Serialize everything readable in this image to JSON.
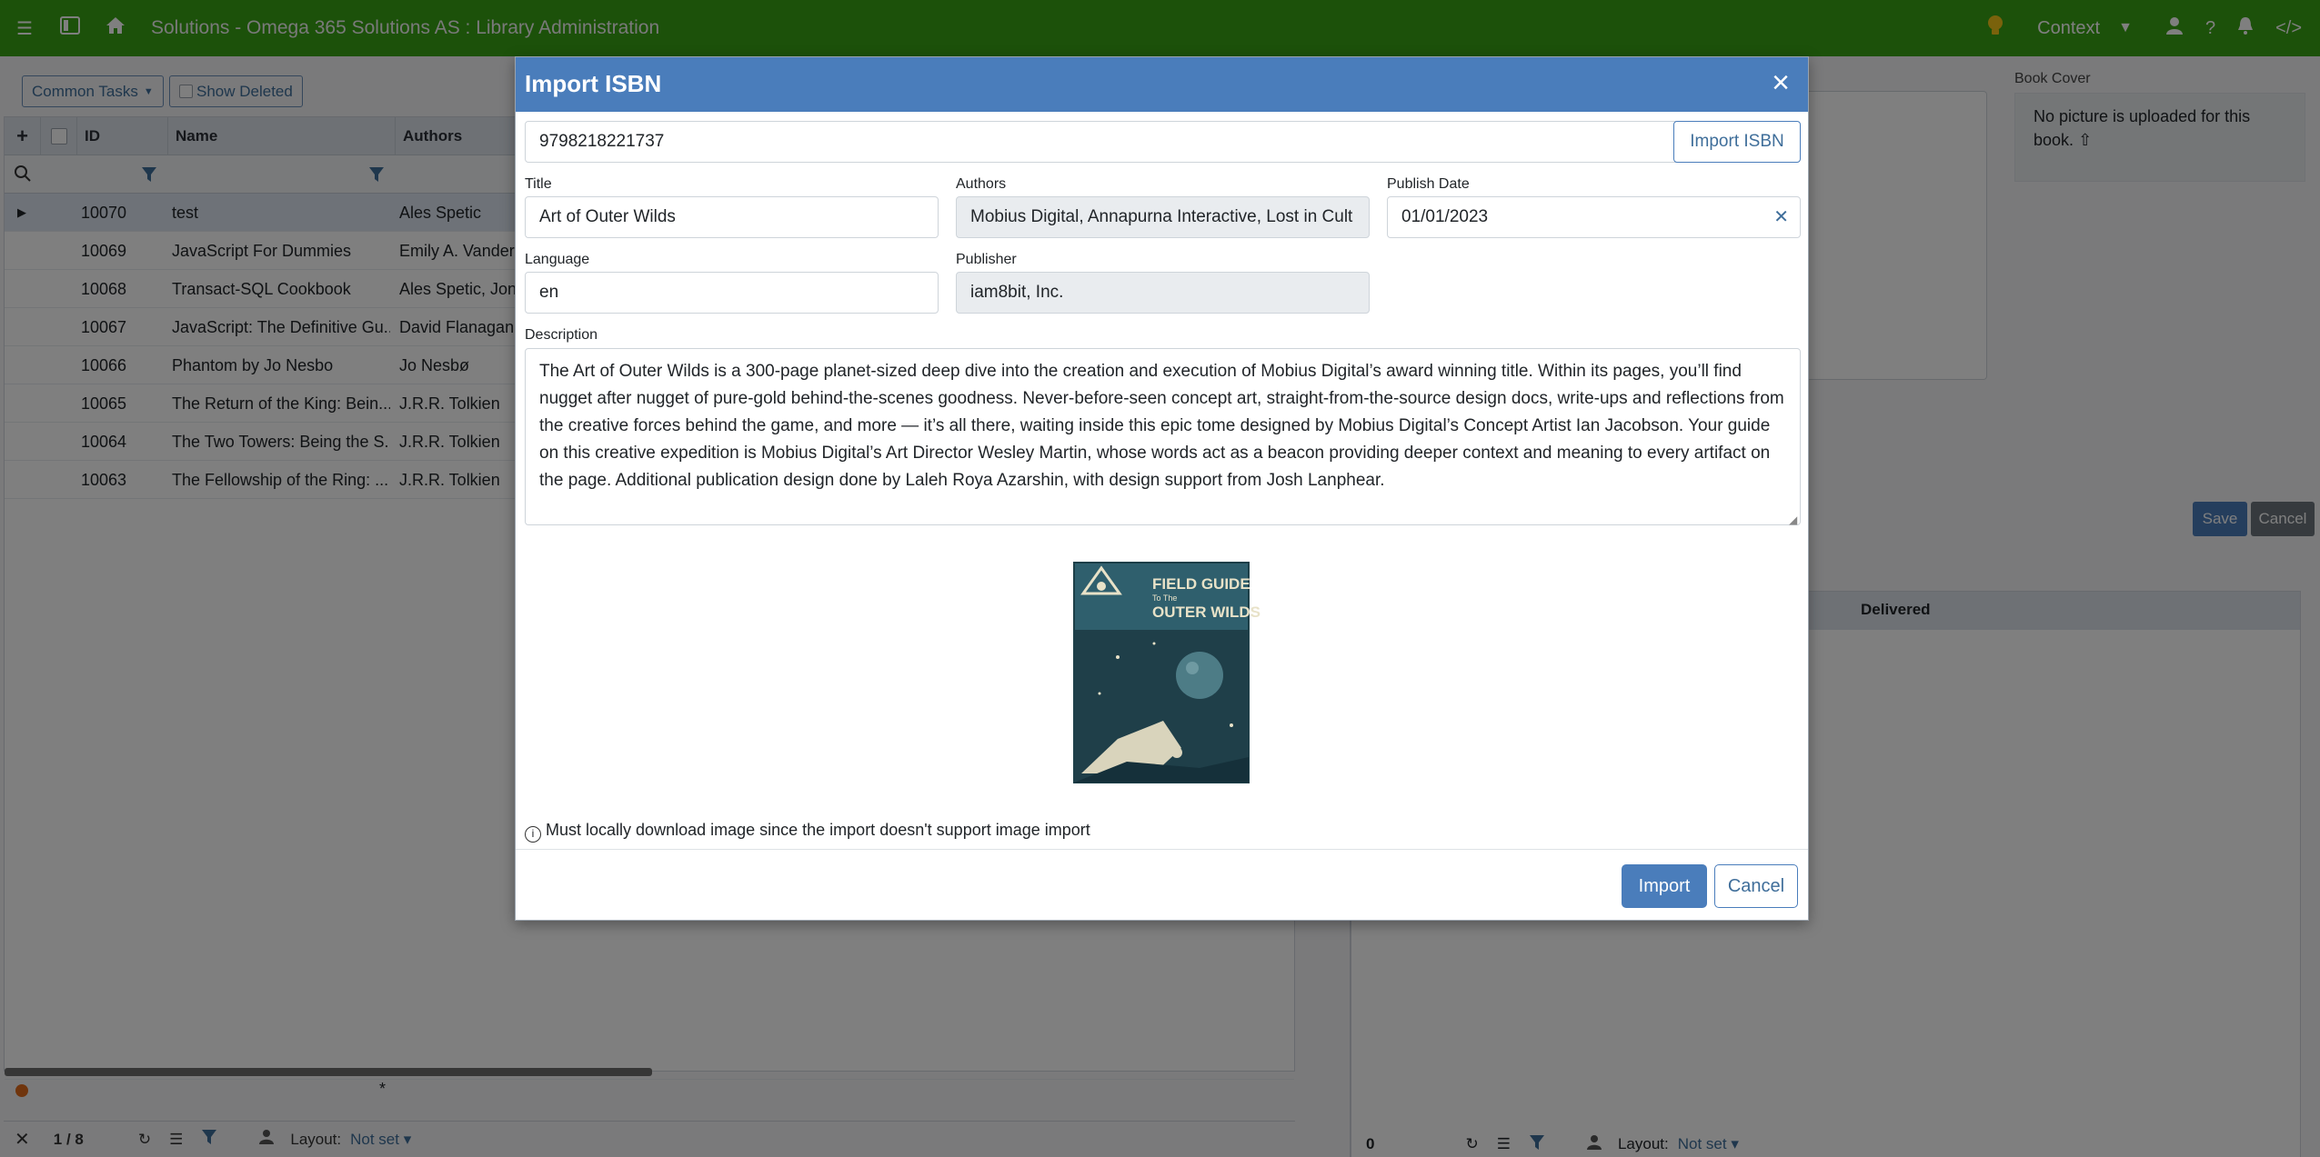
{
  "app": {
    "title": "Solutions - Omega 365 Solutions AS : Library Administration",
    "context_label": "Context"
  },
  "toolbar": {
    "common_tasks": "Common Tasks",
    "show_deleted": "Show Deleted"
  },
  "grid": {
    "columns": [
      "ID",
      "Name",
      "Authors"
    ],
    "rows": [
      {
        "id": "10070",
        "name": "test",
        "authors": "Ales Spetic"
      },
      {
        "id": "10069",
        "name": "JavaScript For Dummies",
        "authors": "Emily A. Vander"
      },
      {
        "id": "10068",
        "name": "Transact-SQL Cookbook",
        "authors": "Ales Spetic, Jona"
      },
      {
        "id": "10067",
        "name": "JavaScript: The Definitive Gu...",
        "authors": "David Flanagan"
      },
      {
        "id": "10066",
        "name": "Phantom by Jo Nesbo",
        "authors": "Jo Nesbø"
      },
      {
        "id": "10065",
        "name": "The Return of the King: Bein...",
        "authors": "J.R.R. Tolkien"
      },
      {
        "id": "10064",
        "name": "The Two Towers: Being the S...",
        "authors": "J.R.R. Tolkien"
      },
      {
        "id": "10063",
        "name": "The Fellowship of the Ring: ...",
        "authors": "J.R.R. Tolkien"
      }
    ],
    "new_row_marker": "*",
    "record_count": "1 / 8",
    "layout_label": "Layout:",
    "layout_value": "Not set"
  },
  "right_panel": {
    "book_cover_label": "Book Cover",
    "no_picture_text": "No picture is uploaded for this book.",
    "save_button": "Save",
    "cancel_button": "Cancel",
    "delivered_column": "Delivered",
    "count": "0",
    "layout_label": "Layout:",
    "layout_value": "Not set"
  },
  "modal": {
    "title": "Import ISBN",
    "isbn_value": "9798218221737",
    "import_isbn_button": "Import ISBN",
    "title_label": "Title",
    "title_value": "Art of Outer Wilds",
    "authors_label": "Authors",
    "authors_value": "Mobius Digital, Annapurna Interactive, Lost in Cult",
    "publish_date_label": "Publish Date",
    "publish_date_value": "01/01/2023",
    "language_label": "Language",
    "language_value": "en",
    "publisher_label": "Publisher",
    "publisher_value": "iam8bit, Inc.",
    "description_label": "Description",
    "description_value": "The Art of Outer Wilds is a 300-page planet-sized deep dive into the creation and execution of Mobius Digital’s award winning title. Within its pages, you’ll find nugget after nugget of pure-gold behind-the-scenes goodness. Never-before-seen concept art, straight-from-the-source design docs, write-ups and reflections from the creative forces behind the game, and more — it’s all there, waiting inside this epic tome designed by Mobius Digital’s Concept Artist Ian Jacobson. Your guide on this creative expedition is Mobius Digital’s Art Director Wesley Martin, whose words act as a beacon providing deeper context and meaning to every artifact on the page. Additional publication design done by Laleh Roya Azarshin, with design support from Josh Lanphear.",
    "cover_title_line1": "FIELD GUIDE",
    "cover_title_line2": "To The",
    "cover_title_line3": "OUTER WILDS",
    "note": "Must locally download image since the import doesn't support image import",
    "import_button": "Import",
    "cancel_button": "Cancel"
  }
}
